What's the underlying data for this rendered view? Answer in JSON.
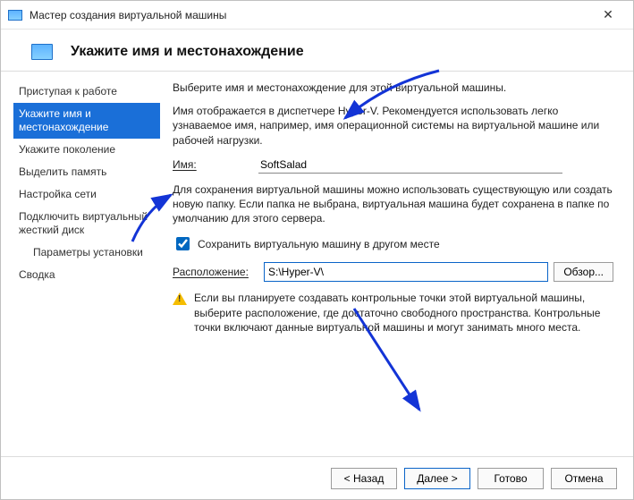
{
  "window": {
    "title": "Мастер создания виртуальной машины"
  },
  "header": {
    "title": "Укажите имя и местонахождение"
  },
  "sidebar": {
    "items": [
      {
        "label": "Приступая к работе"
      },
      {
        "label": "Укажите имя и местонахождение"
      },
      {
        "label": "Укажите поколение"
      },
      {
        "label": "Выделить память"
      },
      {
        "label": "Настройка сети"
      },
      {
        "label": "Подключить виртуальный жесткий диск"
      },
      {
        "label": "Параметры установки"
      },
      {
        "label": "Сводка"
      }
    ]
  },
  "content": {
    "intro": "Выберите имя и местонахождение для этой виртуальной машины.",
    "name_hint": "Имя отображается в диспетчере Hyper-V. Рекомендуется использовать легко узнаваемое имя, например, имя операционной системы на виртуальной машине или рабочей нагрузки.",
    "name_label": "Имя:",
    "name_value": "SoftSalad",
    "location_hint": "Для сохранения виртуальной машины можно использовать существующую или создать новую папку. Если папка не выбрана, виртуальная машина будет сохранена в папке по умолчанию для этого сервера.",
    "store_checkbox_label": "Сохранить виртуальную машину в другом месте",
    "store_checked": true,
    "location_label": "Расположение:",
    "location_value": "S:\\Hyper-V\\",
    "browse_label": "Обзор...",
    "warning": "Если вы планируете создавать контрольные точки этой виртуальной машины, выберите расположение, где достаточно свободного пространства. Контрольные точки включают данные виртуальной машины и могут занимать много места."
  },
  "footer": {
    "back": "< Назад",
    "next": "Далее >",
    "finish": "Готово",
    "cancel": "Отмена"
  }
}
